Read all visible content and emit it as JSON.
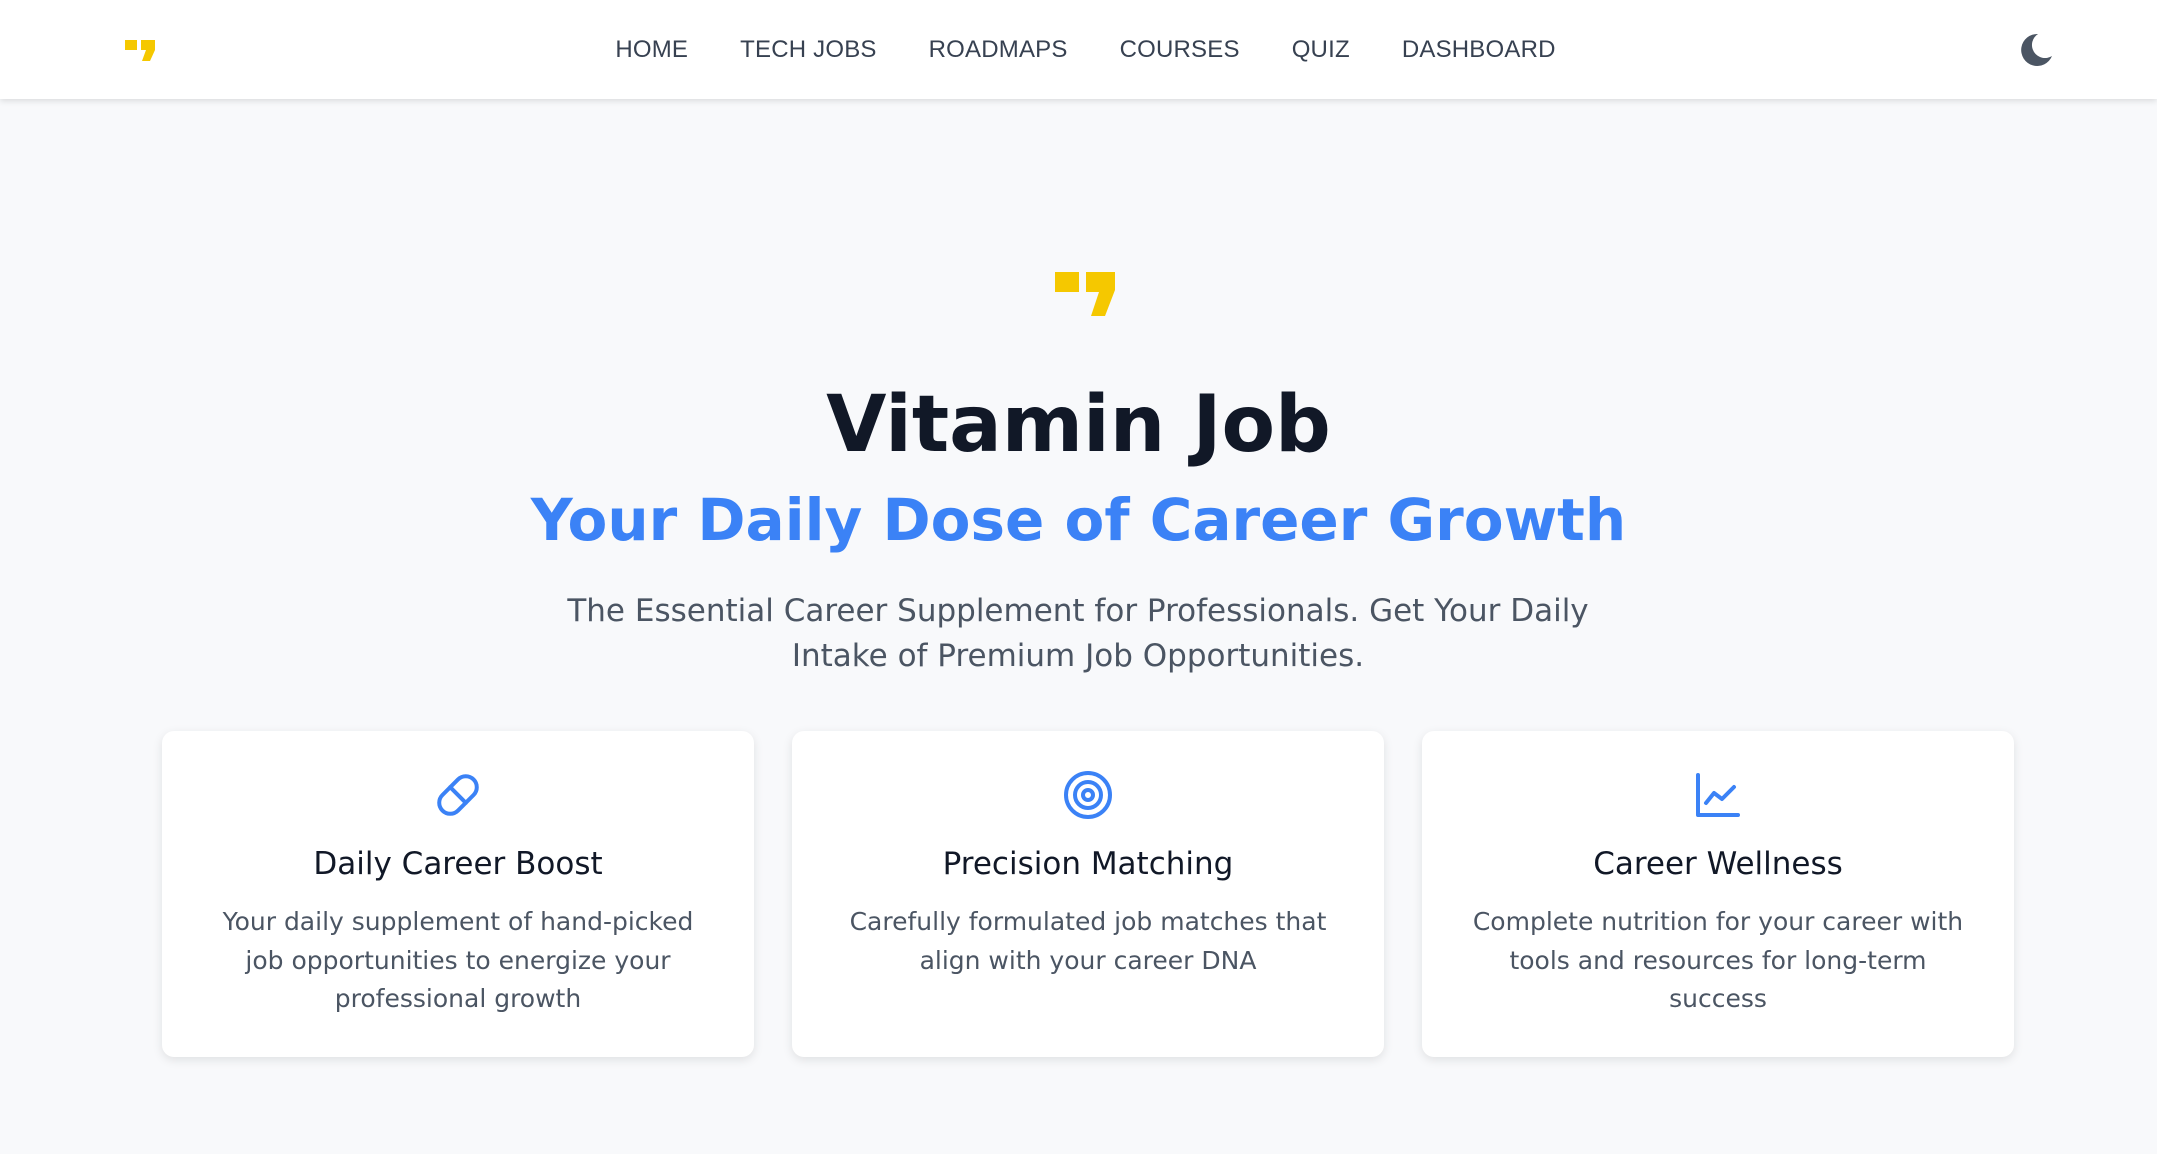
{
  "colors": {
    "brand_yellow": "#f5c800",
    "accent_blue": "#3b82f6",
    "text_dark": "#111827",
    "text_muted": "#4b5563",
    "background": "#f8f9fb"
  },
  "header": {
    "logo_icon": "quote-mark-icon",
    "nav": [
      {
        "label": "HOME"
      },
      {
        "label": "TECH JOBS"
      },
      {
        "label": "ROADMAPS"
      },
      {
        "label": "COURSES"
      },
      {
        "label": "QUIZ"
      },
      {
        "label": "DASHBOARD"
      }
    ],
    "theme_toggle_icon": "moon-icon"
  },
  "hero": {
    "logo_icon": "quote-mark-icon",
    "title": "Vitamin Job",
    "subtitle": "Your Daily Dose of Career Growth",
    "description": "The Essential Career Supplement for Professionals. Get Your Daily Intake of Premium Job Opportunities."
  },
  "features": [
    {
      "icon": "pill-icon",
      "title": "Daily Career Boost",
      "description": "Your daily supplement of hand-picked job opportunities to energize your professional growth"
    },
    {
      "icon": "target-icon",
      "title": "Precision Matching",
      "description": "Carefully formulated job matches that align with your career DNA"
    },
    {
      "icon": "chart-line-icon",
      "title": "Career Wellness",
      "description": "Complete nutrition for your career with tools and resources for long-term success"
    }
  ]
}
